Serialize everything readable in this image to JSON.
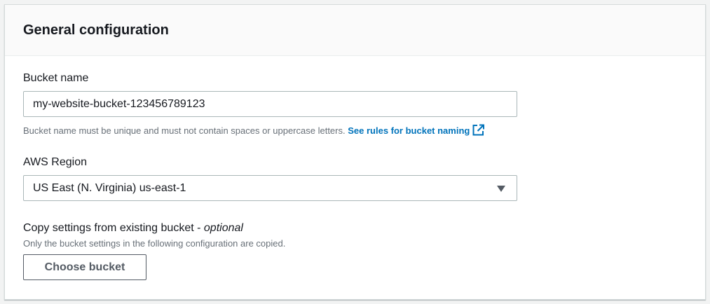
{
  "panel": {
    "title": "General configuration"
  },
  "bucket_name": {
    "label": "Bucket name",
    "value": "my-website-bucket-123456789123",
    "hint": "Bucket name must be unique and must not contain spaces or uppercase letters.",
    "link_text": "See rules for bucket naming",
    "link_icon": "external-link-icon"
  },
  "region": {
    "label": "AWS Region",
    "selected": "US East (N. Virginia) us-east-1",
    "caret_icon": "caret-down-icon"
  },
  "copy_settings": {
    "label": "Copy settings from existing bucket - ",
    "label_optional": "optional",
    "hint": "Only the bucket settings in the following configuration are copied.",
    "button_label": "Choose bucket"
  },
  "colors": {
    "link": "#0073bb",
    "text": "#16191f",
    "hint": "#687078",
    "border": "#aab7b8",
    "header_bg": "#fafafa"
  }
}
